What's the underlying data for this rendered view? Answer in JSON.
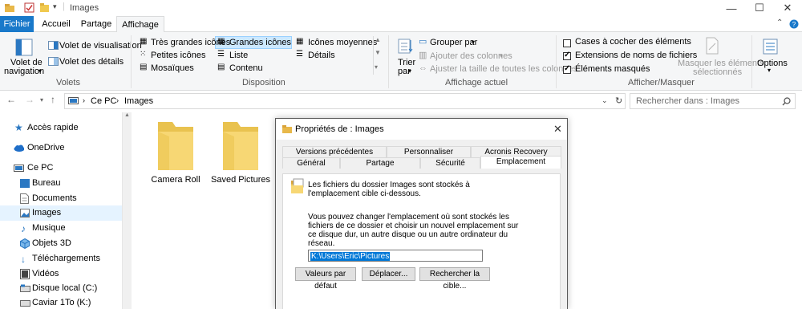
{
  "window": {
    "title": "Images",
    "controls": {
      "minimize": "—",
      "maximize": "☐",
      "close": "✕"
    }
  },
  "tabs": {
    "file": "Fichier",
    "home": "Accueil",
    "share": "Partage",
    "view": "Affichage"
  },
  "ribbon": {
    "panes": {
      "nav_pane": "Volet de",
      "nav_pane2": "navigation",
      "preview": "Volet de visualisation",
      "details": "Volet des détails",
      "group": "Volets"
    },
    "layout": {
      "items": [
        "Très grandes icônes",
        "Grandes icônes",
        "Icônes moyennes",
        "Petites icônes",
        "Liste",
        "Détails",
        "Mosaïques",
        "Contenu"
      ],
      "selected": "Grandes icônes",
      "group": "Disposition"
    },
    "current_view": {
      "sort": "Trier",
      "sort2": "par",
      "group_by": "Grouper par",
      "add_columns": "Ajouter des colonnes",
      "fit_columns": "Ajuster la taille de toutes les colonnes",
      "group": "Affichage actuel"
    },
    "show_hide": {
      "checkboxes": {
        "label": "Cases à cocher des éléments",
        "checked": false
      },
      "extensions": {
        "label": "Extensions de noms de fichiers",
        "checked": true
      },
      "hidden": {
        "label": "Éléments masqués",
        "checked": true
      },
      "hide_selected": "Masquer les éléments",
      "hide_selected2": "sélectionnés",
      "group": "Afficher/Masquer"
    },
    "options": "Options"
  },
  "address": {
    "breadcrumb": [
      "Ce PC",
      "Images"
    ],
    "search_placeholder": "Rechercher dans : Images"
  },
  "nav": [
    {
      "label": "Accès rapide",
      "icon": "star-icon",
      "indent": 1
    },
    {
      "label": "OneDrive",
      "icon": "cloud-icon",
      "indent": 1
    },
    {
      "label": "Ce PC",
      "icon": "computer-icon",
      "indent": 1
    },
    {
      "label": "Bureau",
      "icon": "desktop-folder-icon",
      "indent": 2
    },
    {
      "label": "Documents",
      "icon": "documents-folder-icon",
      "indent": 2
    },
    {
      "label": "Images",
      "icon": "pictures-folder-icon",
      "indent": 2,
      "selected": true
    },
    {
      "label": "Musique",
      "icon": "music-folder-icon",
      "indent": 2
    },
    {
      "label": "Objets 3D",
      "icon": "3d-objects-folder-icon",
      "indent": 2
    },
    {
      "label": "Téléchargements",
      "icon": "downloads-folder-icon",
      "indent": 2
    },
    {
      "label": "Vidéos",
      "icon": "videos-folder-icon",
      "indent": 2
    },
    {
      "label": "Disque local (C:)",
      "icon": "drive-icon",
      "indent": 2
    },
    {
      "label": "Caviar 1To (K:)",
      "icon": "drive-icon",
      "indent": 2
    }
  ],
  "folders": [
    "Camera Roll",
    "Saved Pictures"
  ],
  "dialog": {
    "title": "Propriétés de : Images",
    "tabs_row1": [
      "Versions précédentes",
      "Personnaliser",
      "Acronis Recovery"
    ],
    "tabs_row2": [
      "Général",
      "Partage",
      "Sécurité",
      "Emplacement"
    ],
    "active_tab": "Emplacement",
    "info_line1": "Les fichiers du dossier Images sont stockés à",
    "info_line2": "l'emplacement cible ci-dessous.",
    "desc_line1": "Vous pouvez changer l'emplacement où sont stockés les",
    "desc_line2": "fichiers de ce dossier et choisir un nouvel emplacement sur",
    "desc_line3": "ce disque dur, un autre disque ou un autre ordinateur du",
    "desc_line4": "réseau.",
    "path": "K:\\Users\\Eric\\Pictures",
    "buttons": {
      "default": "Valeurs par défaut",
      "move": "Déplacer...",
      "find": "Rechercher la cible..."
    }
  }
}
